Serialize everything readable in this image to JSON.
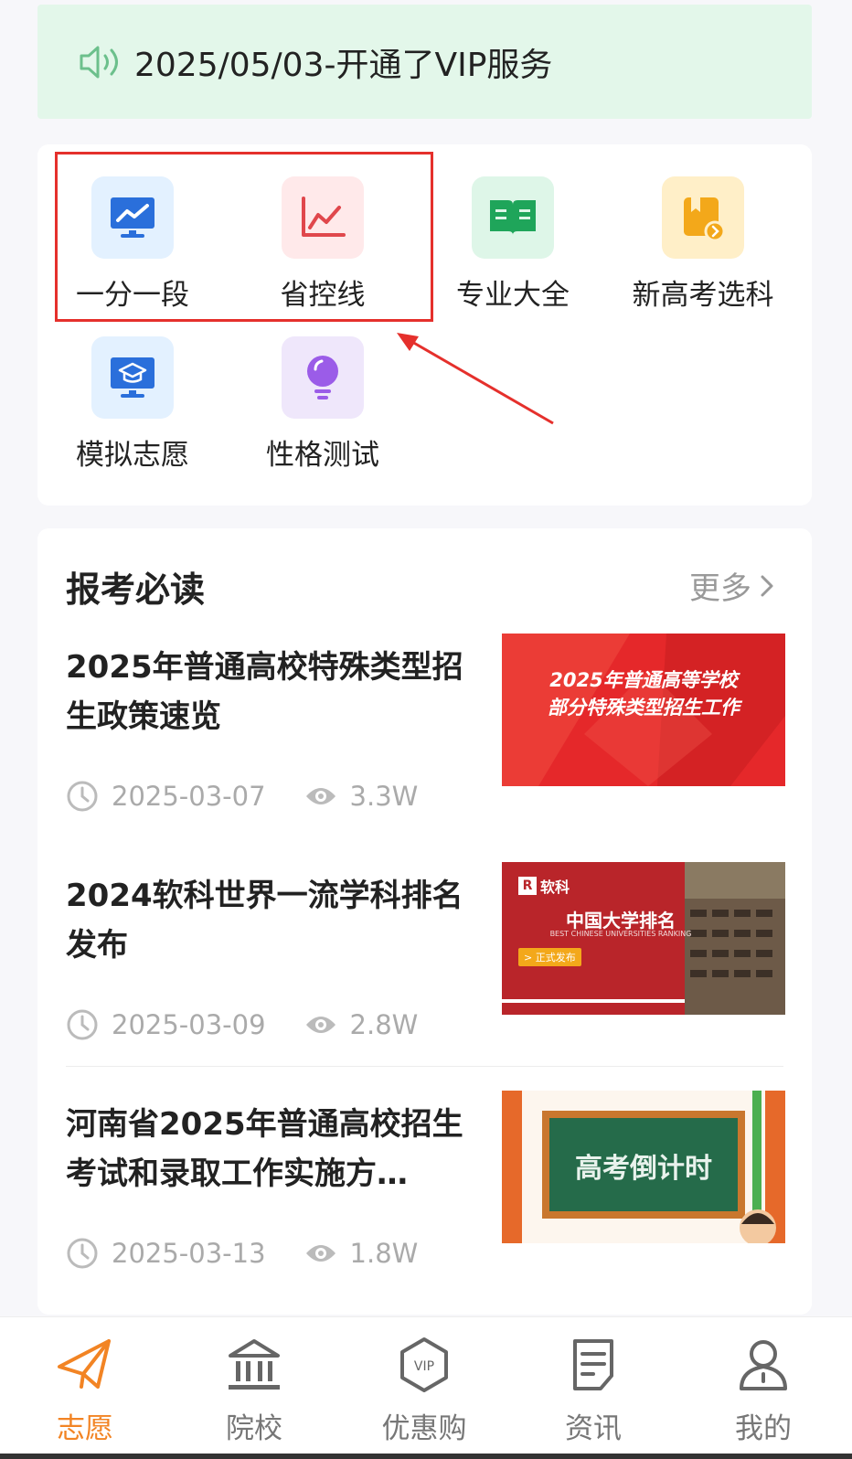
{
  "notice": {
    "text": "2025/05/03-开通了VIP服务",
    "icon": "speaker-icon"
  },
  "grid": {
    "items": [
      {
        "label": "一分一段",
        "icon": "line-chart-monitor-icon",
        "bg": "#e3f1ff",
        "fg": "#2a6fdb"
      },
      {
        "label": "省控线",
        "icon": "line-chart-icon",
        "bg": "#ffe9ea",
        "fg": "#e0474c"
      },
      {
        "label": "专业大全",
        "icon": "open-book-icon",
        "bg": "#def6e8",
        "fg": "#1fa55a"
      },
      {
        "label": "新高考选科",
        "icon": "bookmark-book-icon",
        "bg": "#ffefc8",
        "fg": "#f3a81a"
      },
      {
        "label": "模拟志愿",
        "icon": "graduation-monitor-icon",
        "bg": "#e3f1ff",
        "fg": "#2a6fdb"
      },
      {
        "label": "性格测试",
        "icon": "lightbulb-icon",
        "bg": "#efe7fb",
        "fg": "#9b5ce8"
      }
    ]
  },
  "articles": {
    "title": "报考必读",
    "more": "更多",
    "items": [
      {
        "title": "2025年普通高校特殊类型招生政策速览",
        "date": "2025-03-07",
        "views": "3.3W",
        "thumb_lines": [
          "2025年普通高等学校",
          "部分特殊类型招生工作"
        ]
      },
      {
        "title": "2024软科世界一流学科排名发布",
        "date": "2025-03-09",
        "views": "2.8W",
        "thumb_brand": "软科",
        "thumb_title": "中国大学排名",
        "thumb_sub": "BEST CHINESE UNIVERSITIES RANKING",
        "thumb_badge": "> 正式发布"
      },
      {
        "title": "河南省2025年普通高校招生考试和录取工作实施方…",
        "date": "2025-03-13",
        "views": "1.8W",
        "thumb_text": "高考倒计时"
      }
    ]
  },
  "tabbar": {
    "tabs": [
      {
        "label": "志愿",
        "icon": "paper-plane-icon",
        "active": true
      },
      {
        "label": "院校",
        "icon": "university-building-icon",
        "active": false
      },
      {
        "label": "优惠购",
        "icon": "vip-badge-icon",
        "active": false
      },
      {
        "label": "资讯",
        "icon": "news-document-icon",
        "active": false
      },
      {
        "label": "我的",
        "icon": "user-profile-icon",
        "active": false
      }
    ]
  },
  "colors": {
    "accent": "#f28424",
    "highlight": "#e5302c",
    "notice_bg": "#e3f7ea"
  }
}
